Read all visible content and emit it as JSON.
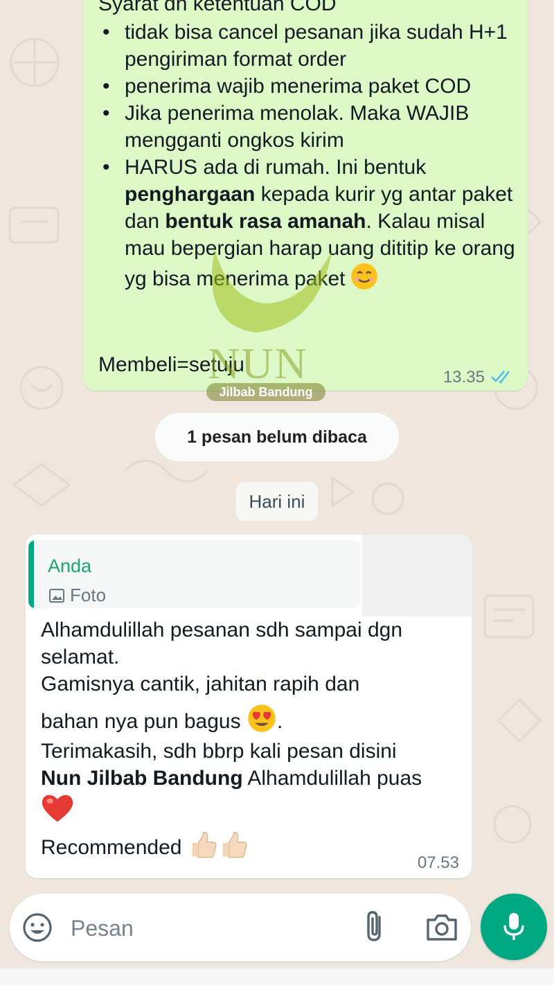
{
  "outgoing": {
    "title": "Syarat dn ketentuan COD",
    "bullet_glyph": "•",
    "bullets": {
      "b1": "tidak bisa cancel pesanan jika  sudah H+1 pengiriman format order",
      "b2": "penerima wajib menerima paket COD",
      "b3": "Jika penerima menolak. Maka WAJIB mengganti ongkos kirim",
      "b4a": "HARUS ada di rumah. Ini bentuk ",
      "b4b": "penghargaan",
      "b4c": " kepada kurir yg antar paket dan ",
      "b4d": "bentuk rasa amanah",
      "b4e": ". Kalau misal mau bepergian harap uang dititip ke orang yg bisa menerima paket"
    },
    "last_line": "Membeli=setuju",
    "time": "13.35"
  },
  "watermark": {
    "brand": "NUN",
    "tagline": "Jilbab Bandung"
  },
  "unread_pill": "1 pesan belum dibaca",
  "date_pill": "Hari ini",
  "incoming": {
    "quote_author": "Anda",
    "quote_type": "Foto",
    "line1": "Alhamdulillah pesanan sdh sampai dgn selamat.",
    "line2": "Gamisnya cantik, jahitan rapih dan",
    "line3": "bahan nya pun bagus",
    "line3_end": ".",
    "line4": "Terimakasih, sdh bbrp kali pesan disini",
    "line5_bold": "Nun Jilbab Bandung",
    "line5_rest": " Alhamdulillah puas",
    "line6": "Recommended",
    "time": "07.53"
  },
  "composer": {
    "placeholder": "Pesan"
  },
  "colors": {
    "outgoing_bubble": "#dcf8c6",
    "accent": "#00a884",
    "quote_name": "#1aa477",
    "read_ticks": "#53bdeb"
  }
}
